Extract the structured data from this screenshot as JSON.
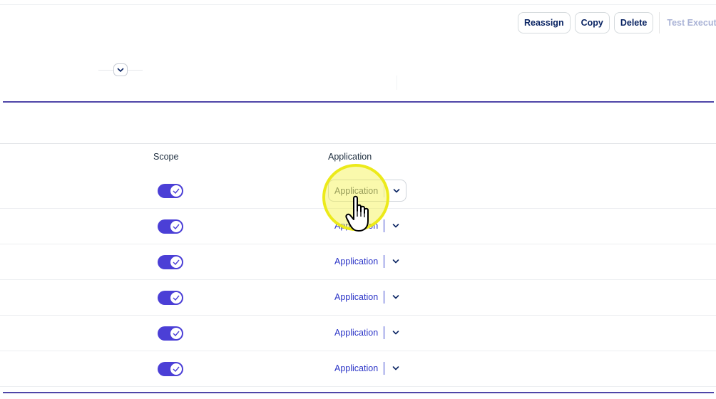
{
  "toolbar": {
    "reassign_label": "Reassign",
    "copy_label": "Copy",
    "delete_label": "Delete",
    "test_execution_label": "Test Execution"
  },
  "table": {
    "columns": {
      "scope": "Scope",
      "application": "Application"
    },
    "rows": [
      {
        "scope_enabled": true,
        "application": "Application"
      },
      {
        "scope_enabled": true,
        "application": "Application"
      },
      {
        "scope_enabled": true,
        "application": "Application"
      },
      {
        "scope_enabled": true,
        "application": "Application"
      },
      {
        "scope_enabled": true,
        "application": "Application"
      },
      {
        "scope_enabled": true,
        "application": "Application"
      }
    ]
  },
  "colors": {
    "accent": "#4b3fd6",
    "link": "#2b34c7",
    "divider": "#4f46a8",
    "click_highlight": "#ecea1a"
  },
  "icons": {
    "collapse": "chevron-down-icon",
    "toggle_check": "check-icon",
    "dropdown": "chevron-down-icon",
    "cursor": "hand-pointer-icon"
  }
}
